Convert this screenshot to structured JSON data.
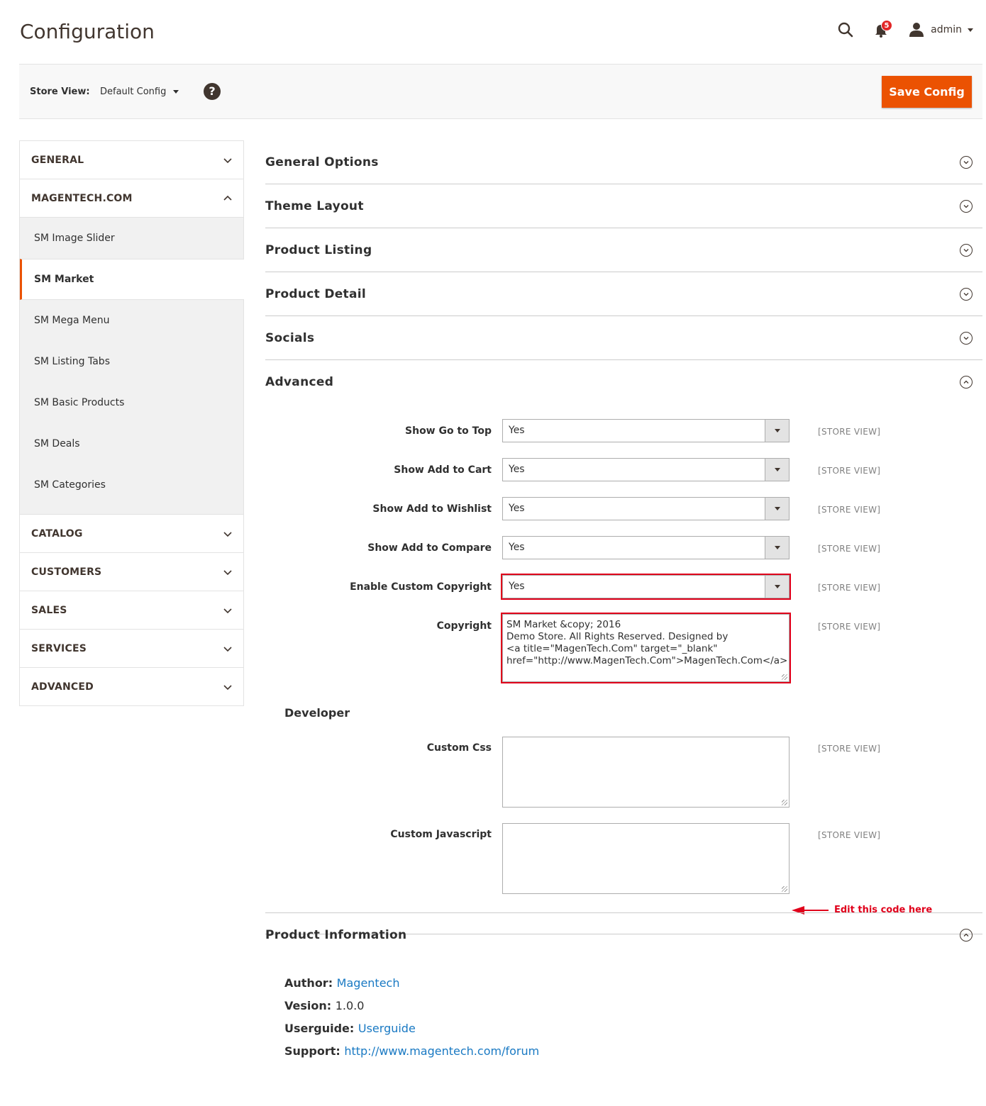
{
  "page": {
    "title": "Configuration"
  },
  "header": {
    "notifications_count": "5",
    "user_name": "admin"
  },
  "store_bar": {
    "label": "Store View:",
    "value": "Default Config",
    "help": "?",
    "save_label": "Save Config"
  },
  "sidebar": {
    "sections": [
      {
        "label": "GENERAL"
      },
      {
        "label": "MAGENTECH.COM"
      },
      {
        "label": "CATALOG"
      },
      {
        "label": "CUSTOMERS"
      },
      {
        "label": "SALES"
      },
      {
        "label": "SERVICES"
      },
      {
        "label": "ADVANCED"
      }
    ],
    "items": [
      {
        "label": "SM Image Slider"
      },
      {
        "label": "SM Market"
      },
      {
        "label": "SM Mega Menu"
      },
      {
        "label": "SM Listing Tabs"
      },
      {
        "label": "SM Basic Products"
      },
      {
        "label": "SM Deals"
      },
      {
        "label": "SM Categories"
      }
    ]
  },
  "main": {
    "sections": [
      {
        "title": "General Options"
      },
      {
        "title": "Theme Layout"
      },
      {
        "title": "Product Listing"
      },
      {
        "title": "Product Detail"
      },
      {
        "title": "Socials"
      },
      {
        "title": "Advanced"
      },
      {
        "title": "Product Information"
      }
    ],
    "advanced": {
      "fields": [
        {
          "label": "Show Go to Top",
          "value": "Yes",
          "scope": "[STORE VIEW]"
        },
        {
          "label": "Show Add to Cart",
          "value": "Yes",
          "scope": "[STORE VIEW]"
        },
        {
          "label": "Show Add to Wishlist",
          "value": "Yes",
          "scope": "[STORE VIEW]"
        },
        {
          "label": "Show Add to Compare",
          "value": "Yes",
          "scope": "[STORE VIEW]"
        },
        {
          "label": "Enable Custom Copyright",
          "value": "Yes",
          "scope": "[STORE VIEW]"
        }
      ],
      "copyright": {
        "label": "Copyright",
        "value": "SM Market &copy; 2016\nDemo Store. All Rights Reserved. Designed by\n<a title=\"MagenTech.Com\" target=\"_blank\"\nhref=\"http://www.MagenTech.Com\">MagenTech.Com</a>",
        "scope": "[STORE VIEW]"
      },
      "annotation": "Edit this code here",
      "developer": {
        "title": "Developer",
        "custom_css": {
          "label": "Custom Css",
          "value": "",
          "scope": "[STORE VIEW]"
        },
        "custom_js": {
          "label": "Custom Javascript",
          "value": "",
          "scope": "[STORE VIEW]"
        }
      }
    },
    "product_information": {
      "author_label": "Author:",
      "author_value": "Magentech",
      "version_label": "Vesion:",
      "version_value": "1.0.0",
      "userguide_label": "Userguide:",
      "userguide_value": "Userguide",
      "support_label": "Support:",
      "support_value": "http://www.magentech.com/forum"
    }
  },
  "colors": {
    "accent": "#eb5202",
    "highlight": "#e0001b",
    "link": "#1979c3"
  }
}
